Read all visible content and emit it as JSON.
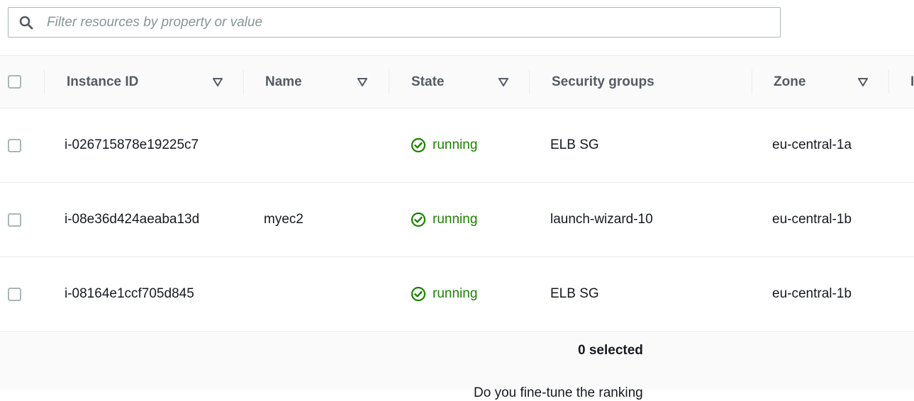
{
  "search": {
    "placeholder": "Filter resources by property or value",
    "icon": "search-icon"
  },
  "table": {
    "columns": [
      {
        "label": "Instance ID",
        "sortable": true
      },
      {
        "label": "Name",
        "sortable": true
      },
      {
        "label": "State",
        "sortable": true
      },
      {
        "label": "Security groups",
        "sortable": false
      },
      {
        "label": "Zone",
        "sortable": true
      },
      {
        "label": "I",
        "sortable": false
      }
    ],
    "rows": [
      {
        "instance_id": "i-026715878e19225c7",
        "name": "",
        "state": "running",
        "security_groups": "ELB SG",
        "zone": "eu-central-1a"
      },
      {
        "instance_id": "i-08e36d424aeaba13d",
        "name": "myec2",
        "state": "running",
        "security_groups": "launch-wizard-10",
        "zone": "eu-central-1b"
      },
      {
        "instance_id": "i-08164e1ccf705d845",
        "name": "",
        "state": "running",
        "security_groups": "ELB SG",
        "zone": "eu-central-1b"
      }
    ]
  },
  "footer": {
    "selected_text": "0 selected",
    "feedback_text": "Do you fine-tune the ranking"
  },
  "colors": {
    "running": "#1d8102",
    "header_bg": "#fafafa",
    "border": "#eaeded"
  }
}
